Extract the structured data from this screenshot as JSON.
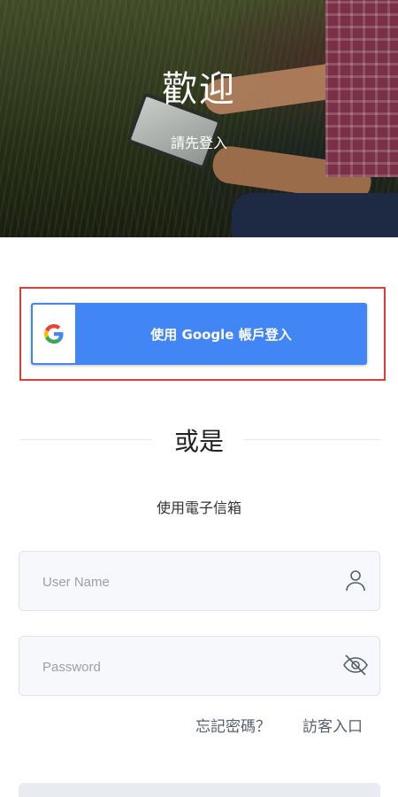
{
  "hero": {
    "title": "歡迎",
    "subtitle": "請先登入"
  },
  "google_login": {
    "label": "使用 Google 帳戶登入",
    "icon": "google-icon",
    "accent": "#4285f4",
    "highlight": "#e53935"
  },
  "divider": {
    "text": "或是"
  },
  "email_section": {
    "label": "使用電子信箱"
  },
  "fields": {
    "username": {
      "placeholder": "User Name",
      "value": "",
      "icon": "user-icon"
    },
    "password": {
      "placeholder": "Password",
      "value": "",
      "icon": "eye-off-icon"
    }
  },
  "links": {
    "forgot_password": "忘記密碼？",
    "guest_entry": "訪客入口"
  }
}
